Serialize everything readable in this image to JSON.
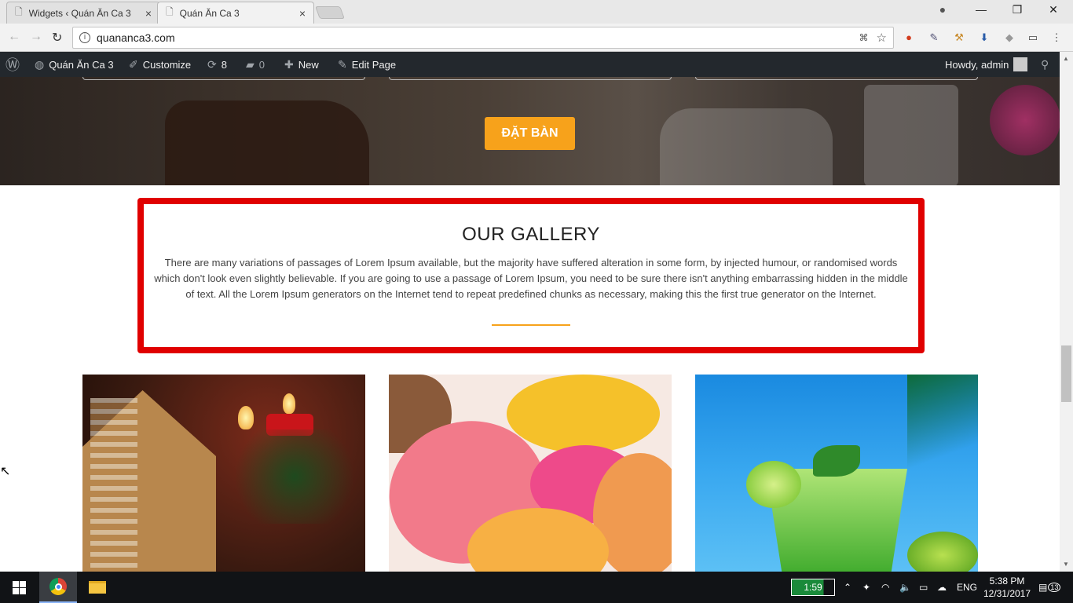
{
  "browser": {
    "tabs": [
      {
        "title": "Widgets ‹ Quán Ăn Ca 3",
        "close": "×"
      },
      {
        "title": "Quán Ăn Ca 3",
        "close": "×"
      }
    ],
    "url": "quananca3.com",
    "window_controls": {
      "minimize": "—",
      "restore": "❐",
      "close": "✕"
    }
  },
  "wp_admin_bar": {
    "site_name": "Quán Ăn Ca 3",
    "customize": "Customize",
    "updates": "8",
    "comments": "0",
    "new": "New",
    "edit_page": "Edit Page",
    "howdy": "Howdy, admin"
  },
  "hero": {
    "button": "ĐẶT BÀN",
    "button_color": "#f7a21b"
  },
  "gallery": {
    "title": "OUR GALLERY",
    "text": "There are many variations of passages of Lorem Ipsum available, but the majority have suffered alteration in some form, by injected humour, or randomised words which don't look even slightly believable. If you are going to use a passage of Lorem Ipsum, you need to be sure there isn't anything embarrassing hidden in the middle of text. All the Lorem Ipsum generators on the Internet tend to repeat predefined chunks as necessary, making this the first true generator on the Internet.",
    "highlight_color": "#e00000"
  },
  "taskbar": {
    "battery_time": "1:59",
    "language": "ENG",
    "time": "5:38 PM",
    "date": "12/31/2017",
    "notifications": "13"
  }
}
